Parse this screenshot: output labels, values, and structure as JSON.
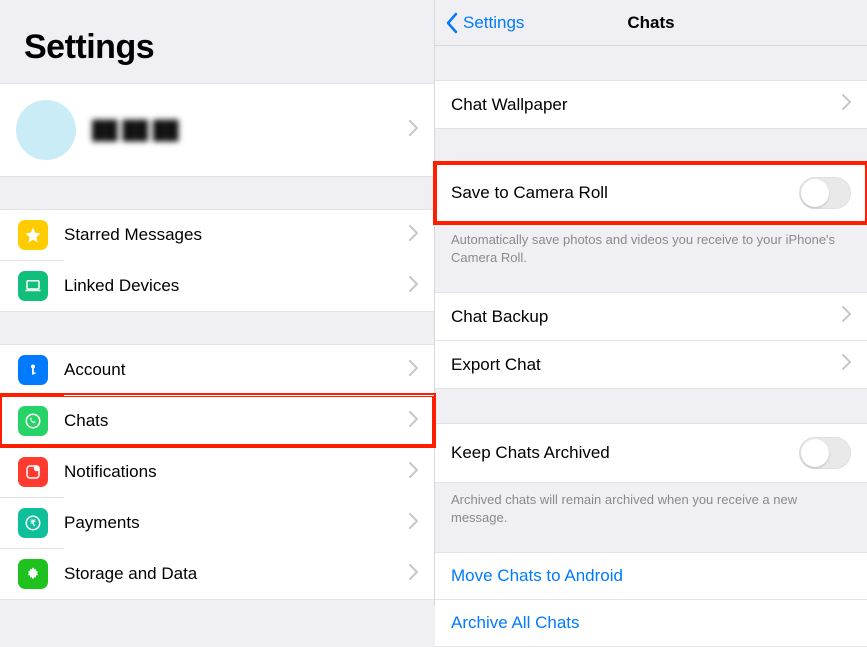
{
  "left": {
    "title": "Settings",
    "profile_name": "██ ██ ██",
    "group1": [
      {
        "label": "Starred Messages"
      },
      {
        "label": "Linked Devices"
      }
    ],
    "group2": [
      {
        "label": "Account"
      },
      {
        "label": "Chats"
      },
      {
        "label": "Notifications"
      },
      {
        "label": "Payments"
      },
      {
        "label": "Storage and Data"
      }
    ]
  },
  "right": {
    "back_label": "Settings",
    "title": "Chats",
    "rows": {
      "wallpaper": "Chat Wallpaper",
      "save_camera": "Save to Camera Roll",
      "save_camera_note": "Automatically save photos and videos you receive to your iPhone's Camera Roll.",
      "backup": "Chat Backup",
      "export": "Export Chat",
      "keep_archived": "Keep Chats Archived",
      "keep_archived_note": "Archived chats will remain archived when you receive a new message.",
      "move_android": "Move Chats to Android",
      "archive_all": "Archive All Chats"
    }
  }
}
